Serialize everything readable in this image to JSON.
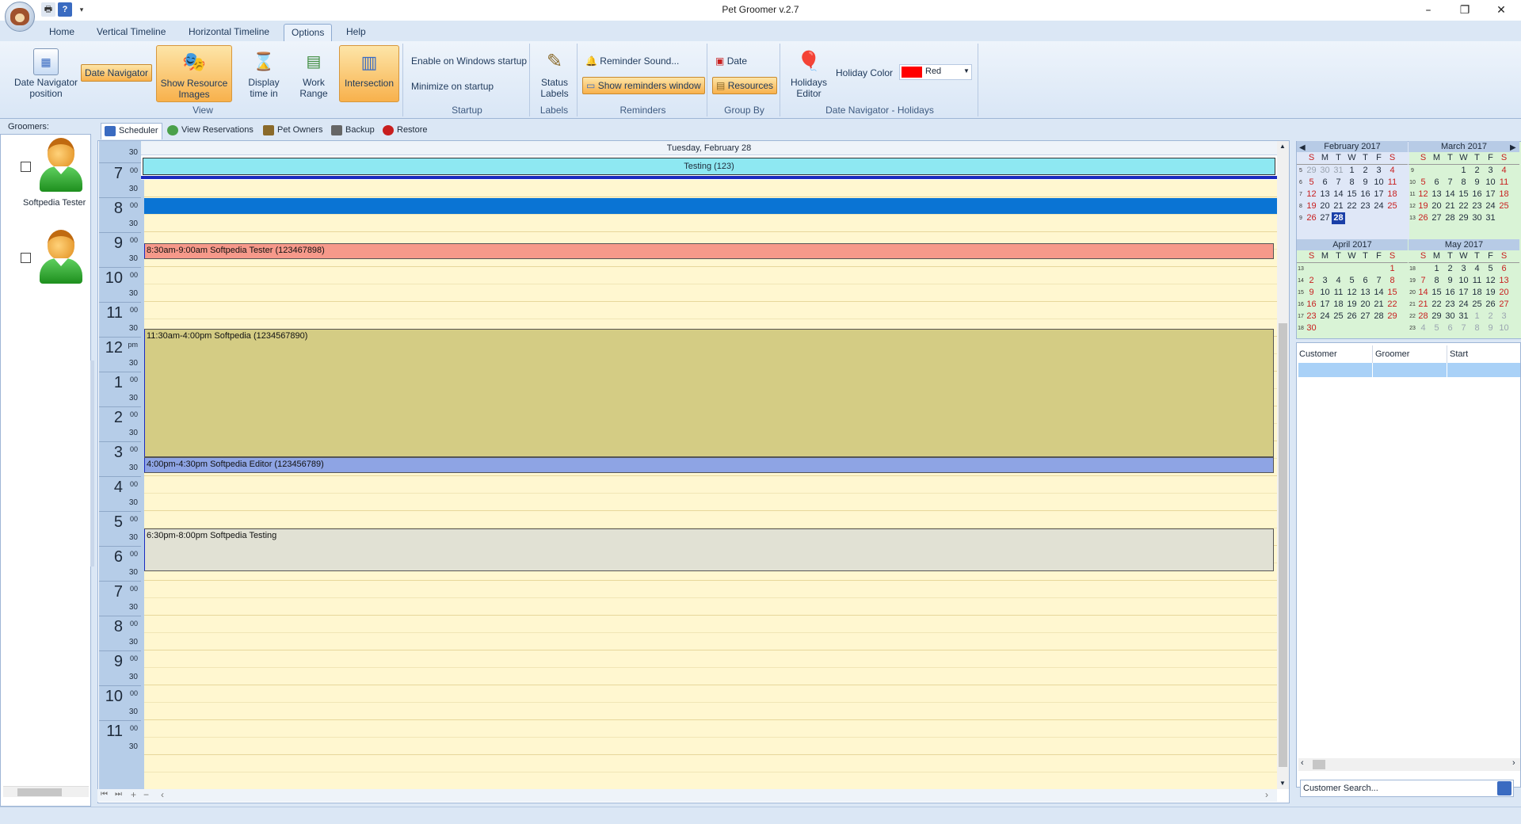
{
  "window": {
    "title": "Pet Groomer v.2.7",
    "minimize": "–",
    "restore": "❐",
    "close": "✕"
  },
  "menu_tabs": [
    "Home",
    "Vertical Timeline",
    "Horizontal Timeline",
    "Options",
    "Help"
  ],
  "active_tab": "Options",
  "ribbon": {
    "view": {
      "label": "View",
      "date_nav_position": "Date Navigator position",
      "date_navigator": "Date Navigator",
      "show_resource_images": "Show Resource Images",
      "display_time_in": "Display time in",
      "work_range": "Work Range",
      "intersection": "Intersection"
    },
    "startup": {
      "label": "Startup",
      "enable_on_startup": "Enable on Windows startup",
      "minimize_on_startup": "Minimize on startup"
    },
    "labels": {
      "label": "Labels",
      "status_labels": "Status Labels"
    },
    "reminders": {
      "label": "Reminders",
      "reminder_sound": "Reminder Sound...",
      "show_reminders_window": "Show reminders window"
    },
    "group_by": {
      "label": "Group By",
      "date": "Date",
      "resources": "Resources"
    },
    "date_nav_holidays": {
      "label": "Date Navigator - Holidays",
      "holidays_editor": "Holidays Editor",
      "holiday_color_label": "Holiday Color",
      "holiday_color_value": "Red",
      "holiday_color_hex": "#ff0000"
    }
  },
  "groomers": {
    "header": "Groomers:",
    "items": [
      {
        "name": "Softpedia Tester"
      },
      {
        "name": ""
      }
    ]
  },
  "doc_tabs": [
    "Scheduler",
    "View Reservations",
    "Pet Owners",
    "Backup",
    "Restore"
  ],
  "scheduler": {
    "day_header": "Tuesday, February 28",
    "all_day_event": "Testing (123)",
    "hours": [
      {
        "h": "7",
        "s": "00"
      },
      {
        "h": "8",
        "s": "00"
      },
      {
        "h": "9",
        "s": "00"
      },
      {
        "h": "10",
        "s": "00"
      },
      {
        "h": "11",
        "s": "00"
      },
      {
        "h": "12",
        "s": "pm"
      },
      {
        "h": "1",
        "s": "00"
      },
      {
        "h": "2",
        "s": "00"
      },
      {
        "h": "3",
        "s": "00"
      },
      {
        "h": "4",
        "s": "00"
      },
      {
        "h": "5",
        "s": "00"
      },
      {
        "h": "6",
        "s": "00"
      },
      {
        "h": "7",
        "s": "00"
      },
      {
        "h": "8",
        "s": "00"
      },
      {
        "h": "9",
        "s": "00"
      },
      {
        "h": "10",
        "s": "00"
      },
      {
        "h": "11",
        "s": "00"
      }
    ],
    "half_label": "30",
    "appointments": [
      {
        "text": "8:30am-9:00am Softpedia Tester (123467898)",
        "color": "#f6998a"
      },
      {
        "text": "11:30am-4:00pm Softpedia (1234567890)",
        "color": "#d4cc84"
      },
      {
        "text": "4:00pm-4:30pm Softpedia Editor (123456789)",
        "color": "#8ea4e4"
      },
      {
        "text": "6:30pm-8:00pm Softpedia Testing",
        "color": "#e1e1d4"
      }
    ]
  },
  "calendar": {
    "weekdays": [
      "S",
      "M",
      "T",
      "W",
      "T",
      "F",
      "S"
    ],
    "months": [
      {
        "title": "February 2017",
        "weeks": [
          [
            "5",
            "29",
            "30",
            "31",
            "1",
            "2",
            "3",
            "4"
          ],
          [
            "6",
            "5",
            "6",
            "7",
            "8",
            "9",
            "10",
            "11"
          ],
          [
            "7",
            "12",
            "13",
            "14",
            "15",
            "16",
            "17",
            "18"
          ],
          [
            "8",
            "19",
            "20",
            "21",
            "22",
            "23",
            "24",
            "25"
          ],
          [
            "9",
            "26",
            "27",
            "28",
            "",
            "",
            "",
            ""
          ]
        ]
      },
      {
        "title": "March 2017",
        "weeks": [
          [
            "9",
            "",
            "",
            "",
            "1",
            "2",
            "3",
            "4"
          ],
          [
            "10",
            "5",
            "6",
            "7",
            "8",
            "9",
            "10",
            "11"
          ],
          [
            "11",
            "12",
            "13",
            "14",
            "15",
            "16",
            "17",
            "18"
          ],
          [
            "12",
            "19",
            "20",
            "21",
            "22",
            "23",
            "24",
            "25"
          ],
          [
            "13",
            "26",
            "27",
            "28",
            "29",
            "30",
            "31",
            ""
          ]
        ]
      },
      {
        "title": "April 2017",
        "weeks": [
          [
            "13",
            "",
            "",
            "",
            "",
            "",
            "",
            "1"
          ],
          [
            "14",
            "2",
            "3",
            "4",
            "5",
            "6",
            "7",
            "8"
          ],
          [
            "15",
            "9",
            "10",
            "11",
            "12",
            "13",
            "14",
            "15"
          ],
          [
            "16",
            "16",
            "17",
            "18",
            "19",
            "20",
            "21",
            "22"
          ],
          [
            "17",
            "23",
            "24",
            "25",
            "26",
            "27",
            "28",
            "29"
          ],
          [
            "18",
            "30",
            "",
            "",
            "",
            "",
            "",
            ""
          ]
        ]
      },
      {
        "title": "May 2017",
        "weeks": [
          [
            "18",
            "",
            "1",
            "2",
            "3",
            "4",
            "5",
            "6"
          ],
          [
            "19",
            "7",
            "8",
            "9",
            "10",
            "11",
            "12",
            "13"
          ],
          [
            "20",
            "14",
            "15",
            "16",
            "17",
            "18",
            "19",
            "20"
          ],
          [
            "21",
            "21",
            "22",
            "23",
            "24",
            "25",
            "26",
            "27"
          ],
          [
            "22",
            "28",
            "29",
            "30",
            "31",
            "1",
            "2",
            "3"
          ],
          [
            "23",
            "4",
            "5",
            "6",
            "7",
            "8",
            "9",
            "10"
          ]
        ]
      }
    ],
    "selected_day": "28"
  },
  "customer_grid": {
    "columns": [
      "Customer",
      "Groomer",
      "Start"
    ],
    "search_placeholder": "Customer Search..."
  }
}
